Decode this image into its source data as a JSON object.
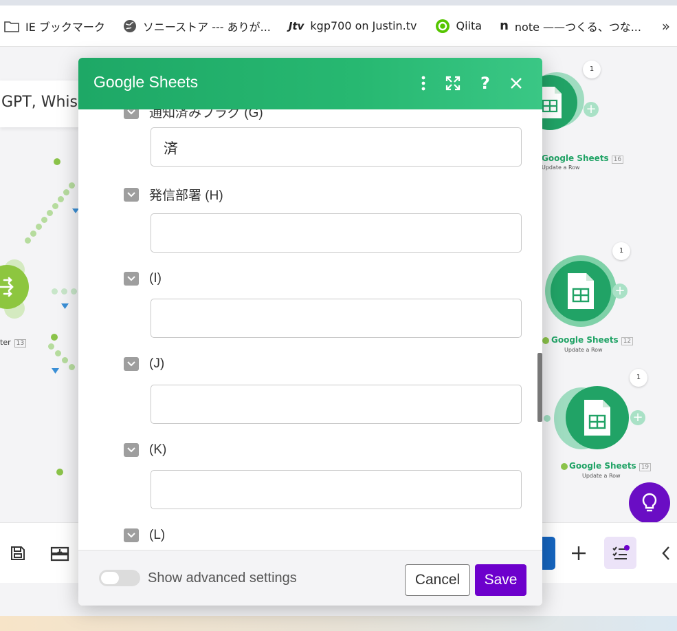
{
  "bookmarks": [
    {
      "label": "IE ブックマーク",
      "icon": "folder-icon"
    },
    {
      "label": "ソニーストア --- ありが...",
      "icon": "globe-icon"
    },
    {
      "label": "kgp700 on Justin.tv",
      "icon": "jtv-icon"
    },
    {
      "label": "Qiita",
      "icon": "qiita-icon"
    },
    {
      "label": "note ——つくる、つな...",
      "icon": "note-icon"
    }
  ],
  "bookmarks_more": "»",
  "scenario": {
    "title": "GPT, Whis"
  },
  "router": {
    "label": "ter",
    "number": "13"
  },
  "modules": [
    {
      "title": "Google Sheets",
      "number": "16",
      "subtitle": "Update a Row",
      "badge": "1"
    },
    {
      "title": "Google Sheets",
      "number": "12",
      "subtitle": "Update a Row",
      "badge": "1"
    },
    {
      "title": "Google Sheets",
      "number": "19",
      "subtitle": "Update a Row",
      "badge": "1"
    }
  ],
  "dialog": {
    "title": "Google Sheets",
    "fields": [
      {
        "label": "通知済みフラグ (G)",
        "value": "済"
      },
      {
        "label": "発信部署 (H)",
        "value": ""
      },
      {
        "label": "(I)",
        "value": ""
      },
      {
        "label": "(J)",
        "value": ""
      },
      {
        "label": "(K)",
        "value": ""
      },
      {
        "label": "(L)",
        "value": ""
      }
    ],
    "footer": {
      "advanced_label": "Show advanced settings",
      "cancel_label": "Cancel",
      "save_label": "Save"
    }
  },
  "colors": {
    "header_green": "#1ea866",
    "save_purple": "#6d00cc",
    "sheets_green": "#21a366"
  }
}
